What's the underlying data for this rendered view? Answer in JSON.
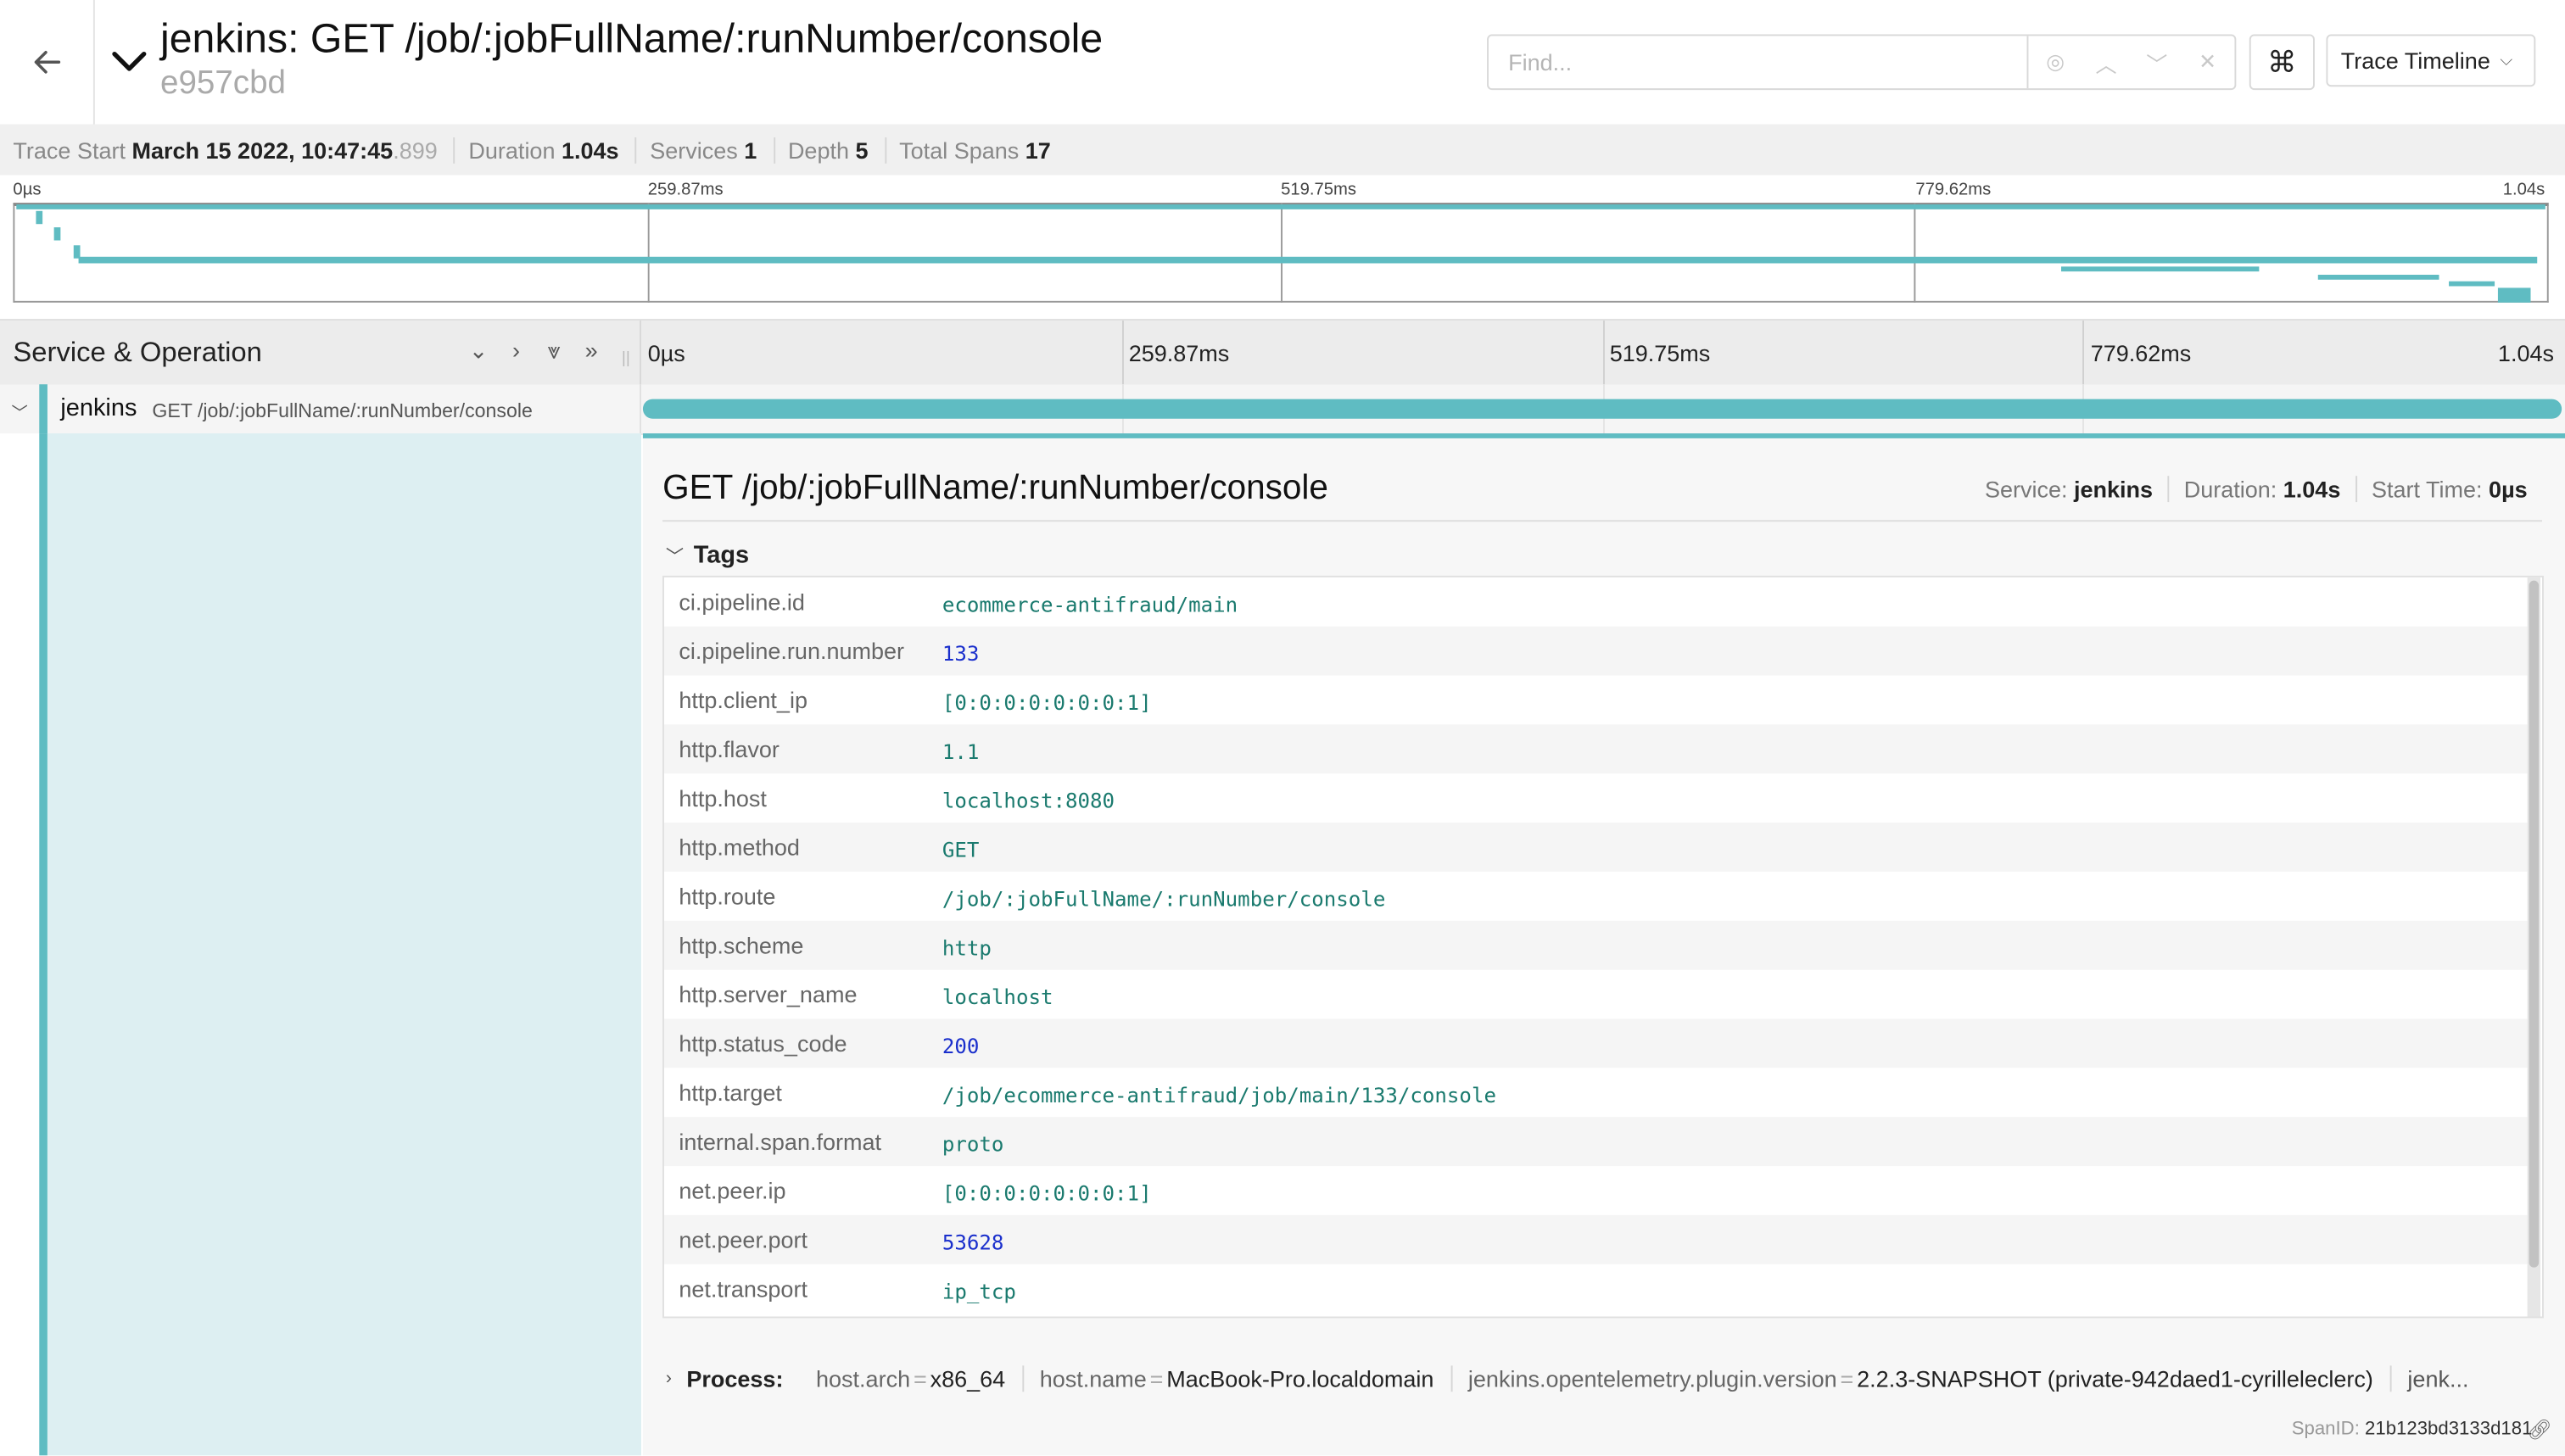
{
  "header": {
    "title": "jenkins: GET /job/:jobFullName/:runNumber/console",
    "trace_id": "e957cbd",
    "find_placeholder": "Find...",
    "view_label": "Trace Timeline",
    "kbd_icon": "⌘"
  },
  "summary": {
    "trace_start_label": "Trace Start",
    "trace_start_value": "March 15 2022, 10:47:45",
    "trace_start_ms": ".899",
    "duration_label": "Duration",
    "duration_value": "1.04s",
    "services_label": "Services",
    "services_value": "1",
    "depth_label": "Depth",
    "depth_value": "5",
    "total_spans_label": "Total Spans",
    "total_spans_value": "17"
  },
  "ticks": [
    "0µs",
    "259.87ms",
    "519.75ms",
    "779.62ms",
    "1.04s"
  ],
  "columns": {
    "service_operation": "Service & Operation"
  },
  "span": {
    "service": "jenkins",
    "operation": "GET /job/:jobFullName/:runNumber/console"
  },
  "detail": {
    "title": "GET /job/:jobFullName/:runNumber/console",
    "service_label": "Service:",
    "service_value": "jenkins",
    "duration_label": "Duration:",
    "duration_value": "1.04s",
    "start_label": "Start Time:",
    "start_value": "0µs",
    "tags_label": "Tags",
    "tags": [
      {
        "key": "ci.pipeline.id",
        "value": "ecommerce-antifraud/main",
        "num": false
      },
      {
        "key": "ci.pipeline.run.number",
        "value": "133",
        "num": true
      },
      {
        "key": "http.client_ip",
        "value": "[0:0:0:0:0:0:0:1]",
        "num": false
      },
      {
        "key": "http.flavor",
        "value": "1.1",
        "num": false
      },
      {
        "key": "http.host",
        "value": "localhost:8080",
        "num": false
      },
      {
        "key": "http.method",
        "value": "GET",
        "num": false
      },
      {
        "key": "http.route",
        "value": "/job/:jobFullName/:runNumber/console",
        "num": false
      },
      {
        "key": "http.scheme",
        "value": "http",
        "num": false
      },
      {
        "key": "http.server_name",
        "value": "localhost",
        "num": false
      },
      {
        "key": "http.status_code",
        "value": "200",
        "num": true
      },
      {
        "key": "http.target",
        "value": "/job/ecommerce-antifraud/job/main/133/console",
        "num": false
      },
      {
        "key": "internal.span.format",
        "value": "proto",
        "num": false
      },
      {
        "key": "net.peer.ip",
        "value": "[0:0:0:0:0:0:0:1]",
        "num": false
      },
      {
        "key": "net.peer.port",
        "value": "53628",
        "num": true
      },
      {
        "key": "net.transport",
        "value": "ip_tcp",
        "num": false
      }
    ],
    "process_label": "Process:",
    "process": [
      {
        "key": "host.arch",
        "value": "x86_64"
      },
      {
        "key": "host.name",
        "value": "MacBook-Pro.localdomain"
      },
      {
        "key": "jenkins.opentelemetry.plugin.version",
        "value": "2.2.3-SNAPSHOT (private-942daed1-cyrilleleclerc)"
      }
    ],
    "process_more": "jenk...",
    "span_id_label": "SpanID:",
    "span_id_value": "21b123bd3133d181"
  },
  "colors": {
    "accent": "#5fbcc2",
    "row_fill": "#ddeff2"
  }
}
